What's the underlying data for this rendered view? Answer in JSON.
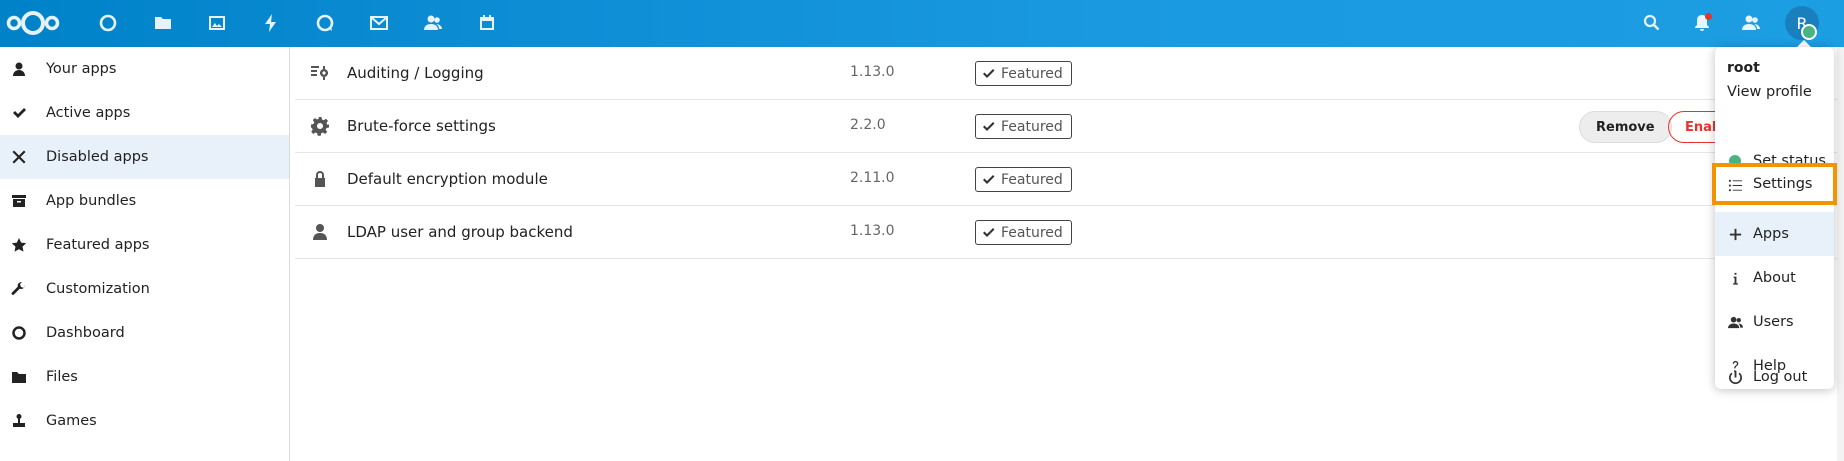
{
  "header": {
    "icons": [
      "nextcloud-logo",
      "dashboard-icon",
      "files-icon",
      "photos-icon",
      "activity-icon",
      "talk-icon",
      "mail-icon",
      "contacts-icon",
      "calendar-icon",
      "search-icon",
      "notifications-icon",
      "contacts-menu-icon"
    ],
    "avatar_letter": "R",
    "accent": "#0082c9"
  },
  "sidebar": {
    "items": [
      {
        "label": "Your apps",
        "icon": "user-icon"
      },
      {
        "label": "Active apps",
        "icon": "check-icon"
      },
      {
        "label": "Disabled apps",
        "icon": "close-icon"
      },
      {
        "label": "App bundles",
        "icon": "archive-icon"
      },
      {
        "label": "Featured apps",
        "icon": "star-icon"
      },
      {
        "label": "Customization",
        "icon": "wrench-icon"
      },
      {
        "label": "Dashboard",
        "icon": "circle-icon"
      },
      {
        "label": "Files",
        "icon": "folder-icon"
      },
      {
        "label": "Games",
        "icon": "joystick-icon"
      }
    ],
    "active_index": 2
  },
  "apps": [
    {
      "name": "Auditing / Logging",
      "version": "1.13.0",
      "badge": "Featured",
      "icon": "audit-icon"
    },
    {
      "name": "Brute-force settings",
      "version": "2.2.0",
      "badge": "Featured",
      "icon": "gear-icon",
      "remove_label": "Remove",
      "enable_label": "Enable"
    },
    {
      "name": "Default encryption module",
      "version": "2.11.0",
      "badge": "Featured",
      "icon": "lock-icon"
    },
    {
      "name": "LDAP user and group backend",
      "version": "1.13.0",
      "badge": "Featured",
      "icon": "user-icon"
    }
  ],
  "menu": {
    "username": "root",
    "view_profile": "View profile",
    "items": [
      {
        "label": "Set status",
        "icon": "status-dot"
      },
      {
        "label": "Settings",
        "icon": "settings-list-icon"
      },
      {
        "label": "Apps",
        "icon": "plus-icon"
      },
      {
        "label": "About",
        "icon": "info-icon"
      },
      {
        "label": "Users",
        "icon": "users-icon"
      },
      {
        "label": "Help",
        "icon": "help-icon"
      },
      {
        "label": "Log out",
        "icon": "power-icon"
      }
    ],
    "active_item": "Apps",
    "highlighted_item": "Settings",
    "highlight_color": "#f29400"
  }
}
